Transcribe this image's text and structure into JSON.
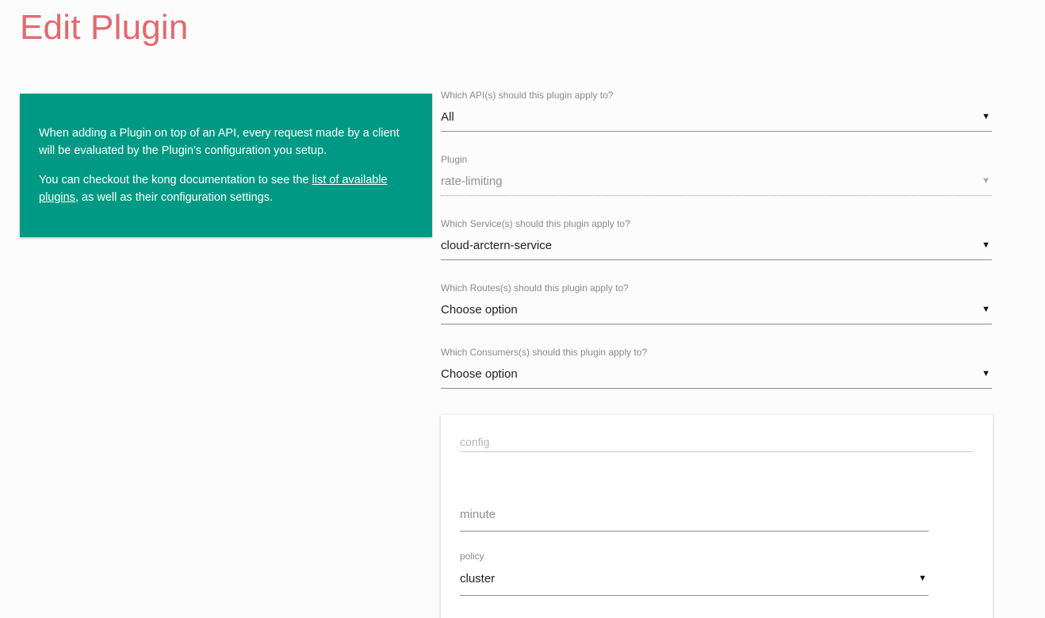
{
  "page": {
    "title": "Edit Plugin"
  },
  "info": {
    "paragraph1": "When adding a Plugin on top of an API, every request made by a client will be evaluated by the Plugin's configuration you setup.",
    "paragraph2_before": "You can checkout the kong documentation to see the ",
    "paragraph2_link": "list of available plugins",
    "paragraph2_after": ", as well as their configuration settings."
  },
  "fields": {
    "api": {
      "label": "Which API(s) should this plugin apply to?",
      "value": "All"
    },
    "plugin": {
      "label": "Plugin",
      "value": "rate-limiting"
    },
    "service": {
      "label": "Which Service(s) should this plugin apply to?",
      "value": "cloud-arctern-service"
    },
    "routes": {
      "label": "Which Routes(s) should this plugin apply to?",
      "value": "Choose option"
    },
    "consumers": {
      "label": "Which Consumers(s) should this plugin apply to?",
      "value": "Choose option"
    }
  },
  "config": {
    "placeholder": "config",
    "minute_placeholder": "minute",
    "policy": {
      "label": "policy",
      "value": "cluster"
    }
  },
  "icons": {
    "dropdown": "▼"
  }
}
